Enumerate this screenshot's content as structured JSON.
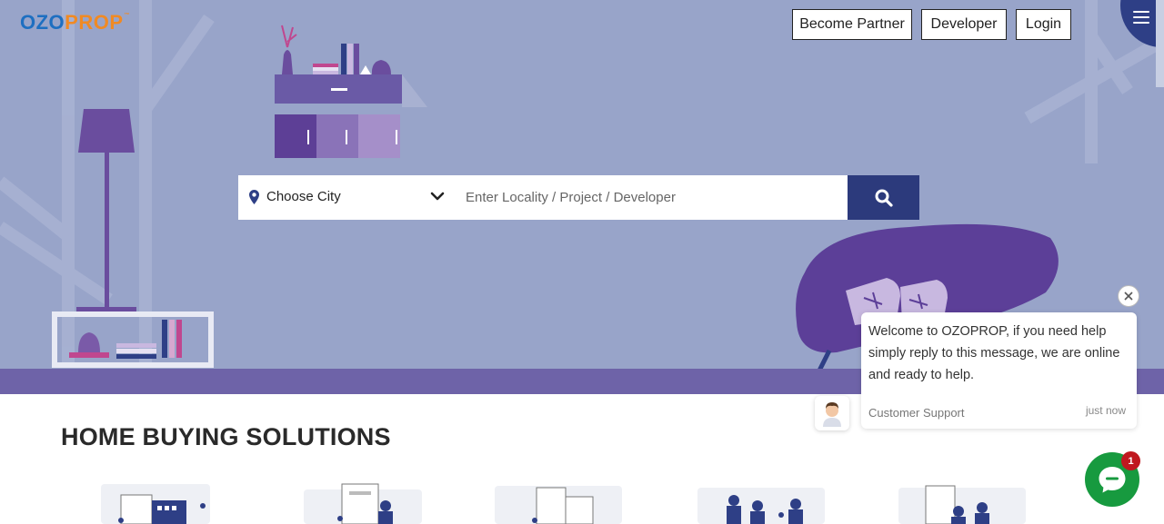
{
  "brand": {
    "logo_part1": "OZO",
    "logo_part2": "PROP",
    "trademark": "™"
  },
  "nav": {
    "become_partner": "Become Partner",
    "developer": "Developer",
    "login": "Login",
    "menu_icon": "hamburger-menu-icon"
  },
  "search": {
    "city_label": "Choose City",
    "locality_placeholder": "Enter Locality / Project / Developer",
    "pin_icon": "map-pin-icon",
    "dropdown_icon": "chevron-down-icon",
    "search_icon": "search-icon"
  },
  "sections": {
    "home_buying_title": "HOME BUYING SOLUTIONS"
  },
  "chat": {
    "message": "Welcome to OZOPROP, if you need help simply reply to this message, we are online and ready to help.",
    "sender": "Customer Support",
    "time": "just now",
    "unread_count": "1",
    "close_icon": "close-icon",
    "launcher_icon": "chat-bubble-icon"
  },
  "colors": {
    "hero_bg": "#98a4c9",
    "floor": "#6e63a8",
    "logo_blue": "#1e6fc1",
    "logo_orange": "#f08a24",
    "search_button": "#2c3a7c",
    "chat_green": "#179a3f",
    "badge_red": "#c0181f"
  }
}
